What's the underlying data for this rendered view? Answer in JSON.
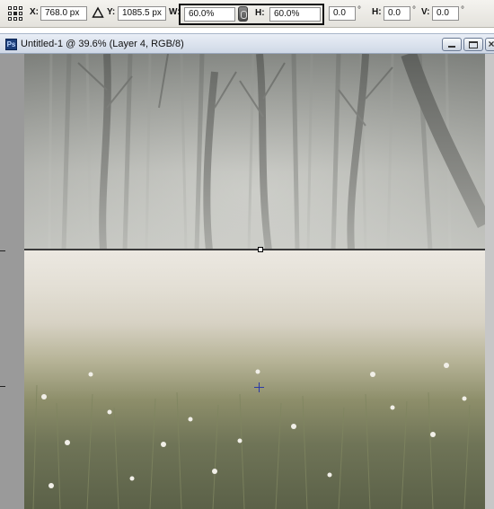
{
  "options_bar": {
    "x_label": "X:",
    "x_value": "768.0 px",
    "y_label": "Y:",
    "y_value": "1085.5 px",
    "w_label": "W:",
    "w_value": "60.0%",
    "h_label": "H:",
    "h_value": "60.0%",
    "angle_value": "0.0",
    "hskew_label": "H:",
    "hskew_value": "0.0",
    "vskew_label": "V:",
    "vskew_value": "0.0",
    "degree_symbol": "°"
  },
  "document_window": {
    "app_icon_text": "Ps",
    "title": "Untitled-1 @ 39.6% (Layer 4, RGB/8)"
  },
  "icons": [
    "reference-point-icon",
    "delta-angle-icon",
    "link-chain-icon",
    "photoshop-icon",
    "minimize-icon",
    "maximize-icon",
    "close-icon",
    "move-crosshair-icon"
  ],
  "colors": {
    "highlight_box": "#111111",
    "title_bar": "#dbe2ee",
    "canvas_frame": "#808080"
  }
}
